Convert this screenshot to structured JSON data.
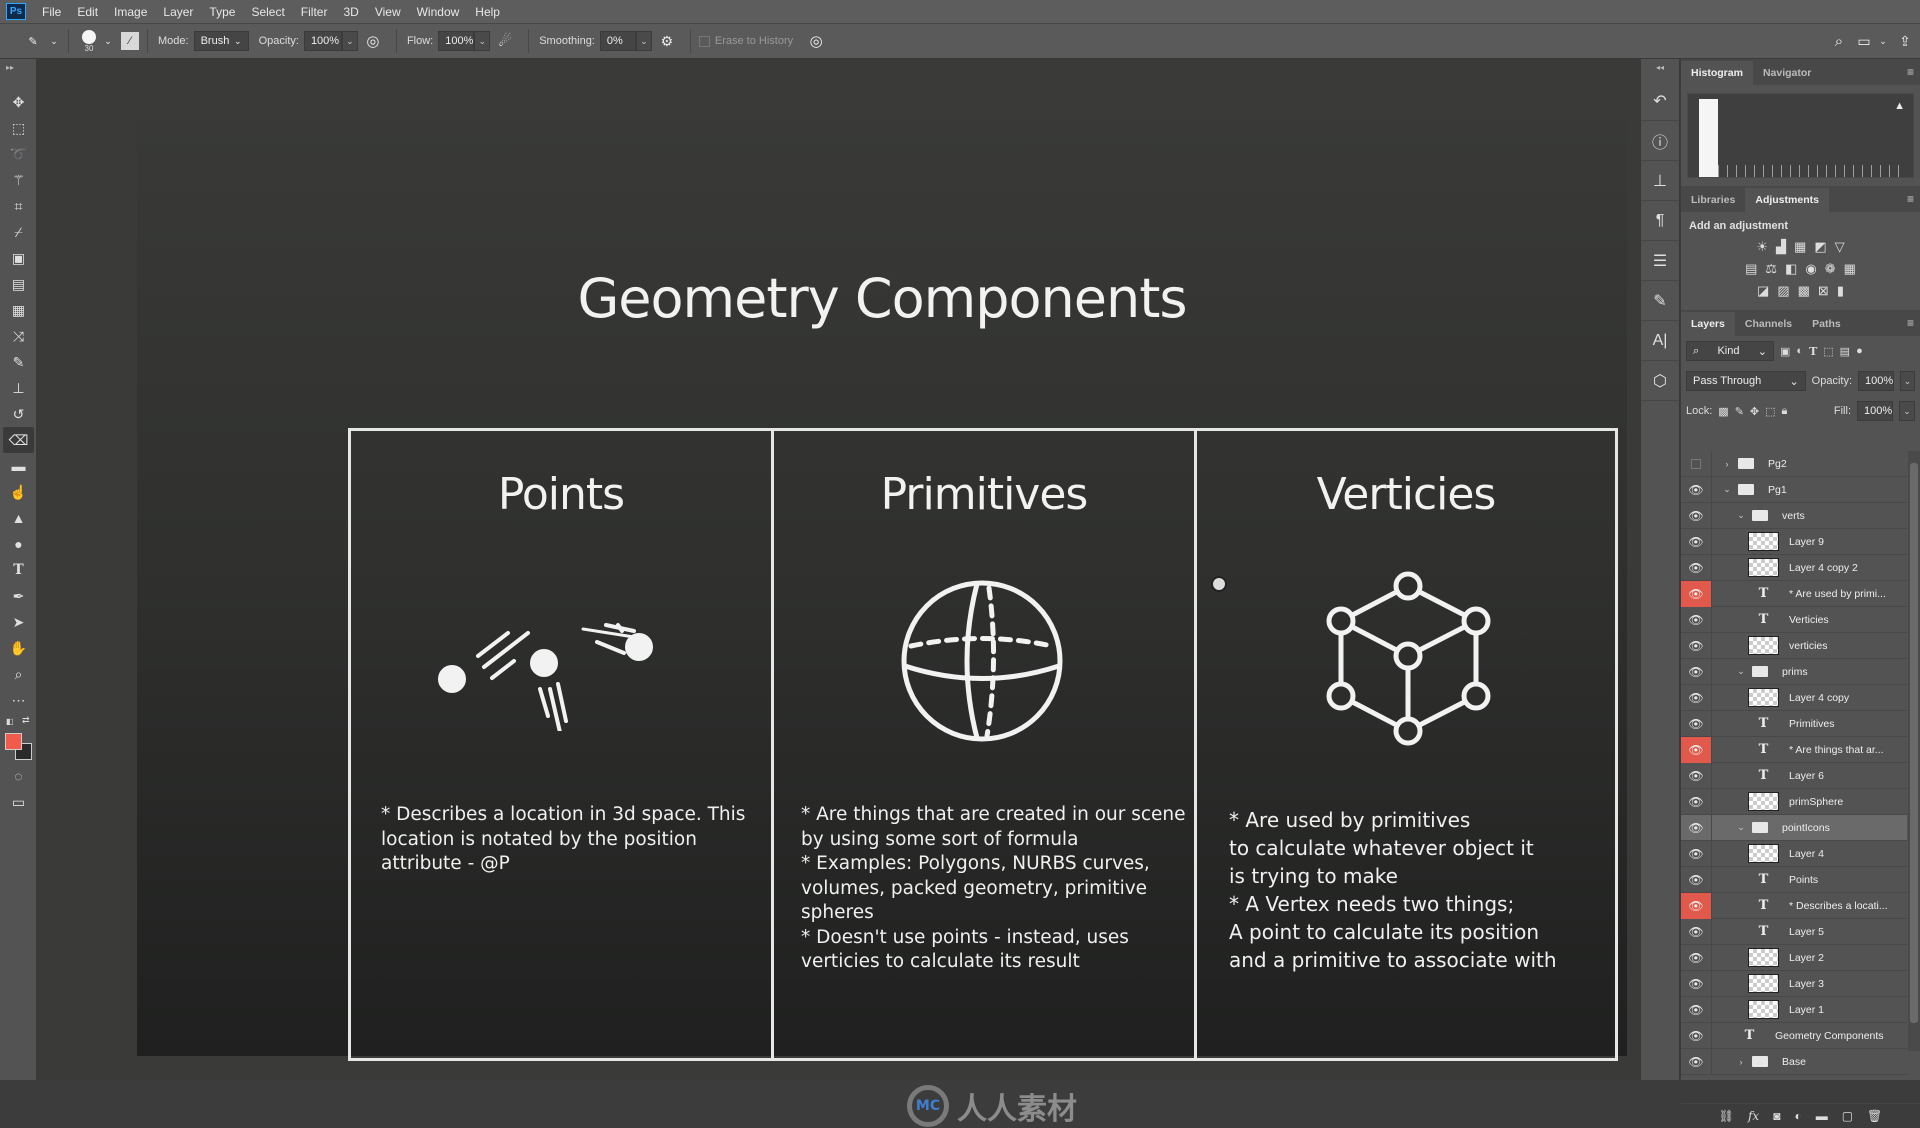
{
  "app": {
    "logo": "Ps"
  },
  "menu": [
    "File",
    "Edit",
    "Image",
    "Layer",
    "Type",
    "Select",
    "Filter",
    "3D",
    "View",
    "Window",
    "Help"
  ],
  "options": {
    "tool_icon": "eraser-icon",
    "brush_size": "30",
    "mode_label": "Mode:",
    "mode_value": "Brush",
    "opacity_label": "Opacity:",
    "opacity_value": "100%",
    "flow_label": "Flow:",
    "flow_value": "100%",
    "smoothing_label": "Smoothing:",
    "smoothing_value": "0%",
    "erase_to_history_label": "Erase to History",
    "erase_to_history_checked": false
  },
  "canvas": {
    "title": "Geometry Components",
    "columns": [
      {
        "heading": "Points",
        "icon": "moving-points-icon",
        "text": "*  Describes a location in 3d space.  This\nlocation is notated by the position\nattribute - @P"
      },
      {
        "heading": "Primitives",
        "icon": "sphere-icon",
        "text": "*  Are things that are created in our scene\nby using some sort of formula\n*  Examples:  Polygons, NURBS curves,\nvolumes, packed geometry, primitive\nspheres\n*  Doesn't use points - instead, uses\nverticies to calculate its result"
      },
      {
        "heading": "Verticies",
        "icon": "vertex-cube-icon",
        "text": "*  Are used by primitives\nto calculate whatever object it\nis trying to make\n*  A Vertex needs two things;\n A point to calculate its position\n and a primitive to associate with"
      }
    ]
  },
  "watermark": {
    "text": "人人素材",
    "logo": "MC"
  },
  "colors": {
    "foreground": "#f15b4c",
    "background": "#2a2a2a",
    "accent_red": "#e0594b"
  },
  "panels": {
    "histogram_tabs": [
      "Histogram",
      "Navigator"
    ],
    "adjust_tabs": [
      "Libraries",
      "Adjustments"
    ],
    "add_adjustment": "Add an adjustment",
    "layers_tabs": [
      "Layers",
      "Channels",
      "Paths"
    ],
    "filter_kind": "Kind",
    "blend_mode": "Pass Through",
    "opacity_label": "Opacity:",
    "opacity_value": "100%",
    "lock_label": "Lock:",
    "fill_label": "Fill:",
    "fill_value": "100%"
  },
  "layers": [
    {
      "name": "Pg2",
      "type": "group",
      "depth": 0,
      "visible": false,
      "expanded": false
    },
    {
      "name": "Pg1",
      "type": "group",
      "depth": 0,
      "visible": true,
      "expanded": true
    },
    {
      "name": "verts",
      "type": "group",
      "depth": 1,
      "visible": true,
      "expanded": true
    },
    {
      "name": "Layer 9",
      "type": "pixel",
      "depth": 2,
      "visible": true
    },
    {
      "name": "Layer 4 copy 2",
      "type": "pixel",
      "depth": 2,
      "visible": true
    },
    {
      "name": "*  Are used by primi...",
      "type": "text",
      "depth": 2,
      "visible": true,
      "flag": "red"
    },
    {
      "name": "Verticies",
      "type": "text",
      "depth": 2,
      "visible": true
    },
    {
      "name": "verticies",
      "type": "pixel",
      "depth": 2,
      "visible": true
    },
    {
      "name": "prims",
      "type": "group",
      "depth": 1,
      "visible": true,
      "expanded": true
    },
    {
      "name": "Layer 4 copy",
      "type": "pixel",
      "depth": 2,
      "visible": true
    },
    {
      "name": "Primitives",
      "type": "text",
      "depth": 2,
      "visible": true
    },
    {
      "name": "*  Are things that ar...",
      "type": "text",
      "depth": 2,
      "visible": true,
      "flag": "red"
    },
    {
      "name": "Layer 6",
      "type": "text",
      "depth": 2,
      "visible": true
    },
    {
      "name": "primSphere",
      "type": "pixel",
      "depth": 2,
      "visible": true
    },
    {
      "name": "pointIcons",
      "type": "group",
      "depth": 1,
      "visible": true,
      "expanded": true,
      "selected": true
    },
    {
      "name": "Layer 4",
      "type": "pixel",
      "depth": 2,
      "visible": true
    },
    {
      "name": "Points",
      "type": "text",
      "depth": 2,
      "visible": true
    },
    {
      "name": "*  Describes a locati...",
      "type": "text",
      "depth": 2,
      "visible": true,
      "flag": "red"
    },
    {
      "name": "Layer 5",
      "type": "text",
      "depth": 2,
      "visible": true
    },
    {
      "name": "Layer 2",
      "type": "pixel",
      "depth": 2,
      "visible": true
    },
    {
      "name": "Layer 3",
      "type": "pixel",
      "depth": 2,
      "visible": true
    },
    {
      "name": "Layer 1",
      "type": "pixel",
      "depth": 2,
      "visible": true
    },
    {
      "name": "Geometry Components",
      "type": "text",
      "depth": 1,
      "visible": true
    },
    {
      "name": "Base",
      "type": "group",
      "depth": 1,
      "visible": true,
      "expanded": false
    }
  ],
  "tools": [
    "move",
    "marquee",
    "lasso",
    "magic-wand",
    "crop",
    "eyedropper",
    "spot-healing",
    "healing",
    "patch",
    "content-aware-move",
    "brush",
    "clone-stamp",
    "history-brush",
    "eraser",
    "gradient",
    "smudge",
    "sharpen",
    "sponge",
    "type",
    "pen",
    "path-select",
    "hand",
    "zoom",
    "more"
  ],
  "active_tool": "eraser"
}
